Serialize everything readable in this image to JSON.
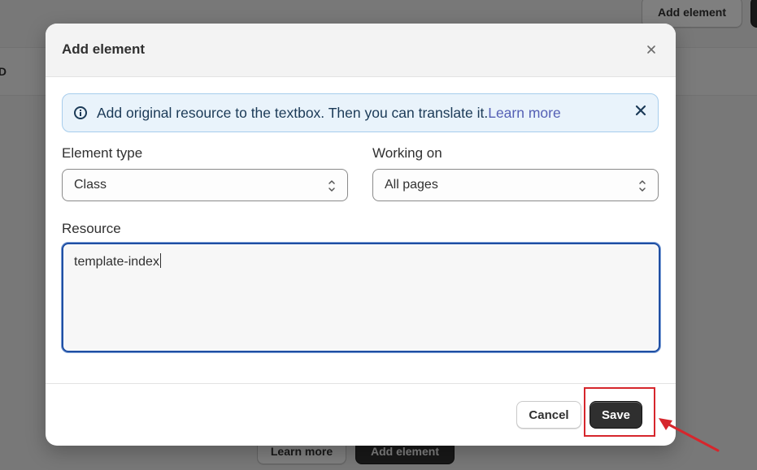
{
  "background": {
    "top_button_label": "Add element",
    "column_header": "ID",
    "bottom_buttons": {
      "learn_more": "Learn more",
      "add_element": "Add element"
    }
  },
  "modal": {
    "title": "Add element",
    "close_icon": "close-icon",
    "banner": {
      "icon": "info-icon",
      "text": "Add original resource to the textbox. Then you can translate it.",
      "link": "Learn more",
      "close_icon": "close-icon"
    },
    "element_type": {
      "label": "Element type",
      "value": "Class"
    },
    "working_on": {
      "label": "Working on",
      "value": "All pages"
    },
    "resource": {
      "label": "Resource",
      "value": "template-index"
    },
    "footer": {
      "cancel": "Cancel",
      "save": "Save"
    }
  },
  "colors": {
    "accent_link": "#5560b5",
    "banner_bg": "#e9f3fb",
    "focus_border": "#1f4fa3",
    "highlight": "#d6262c",
    "primary_button": "#2f2f2f"
  }
}
